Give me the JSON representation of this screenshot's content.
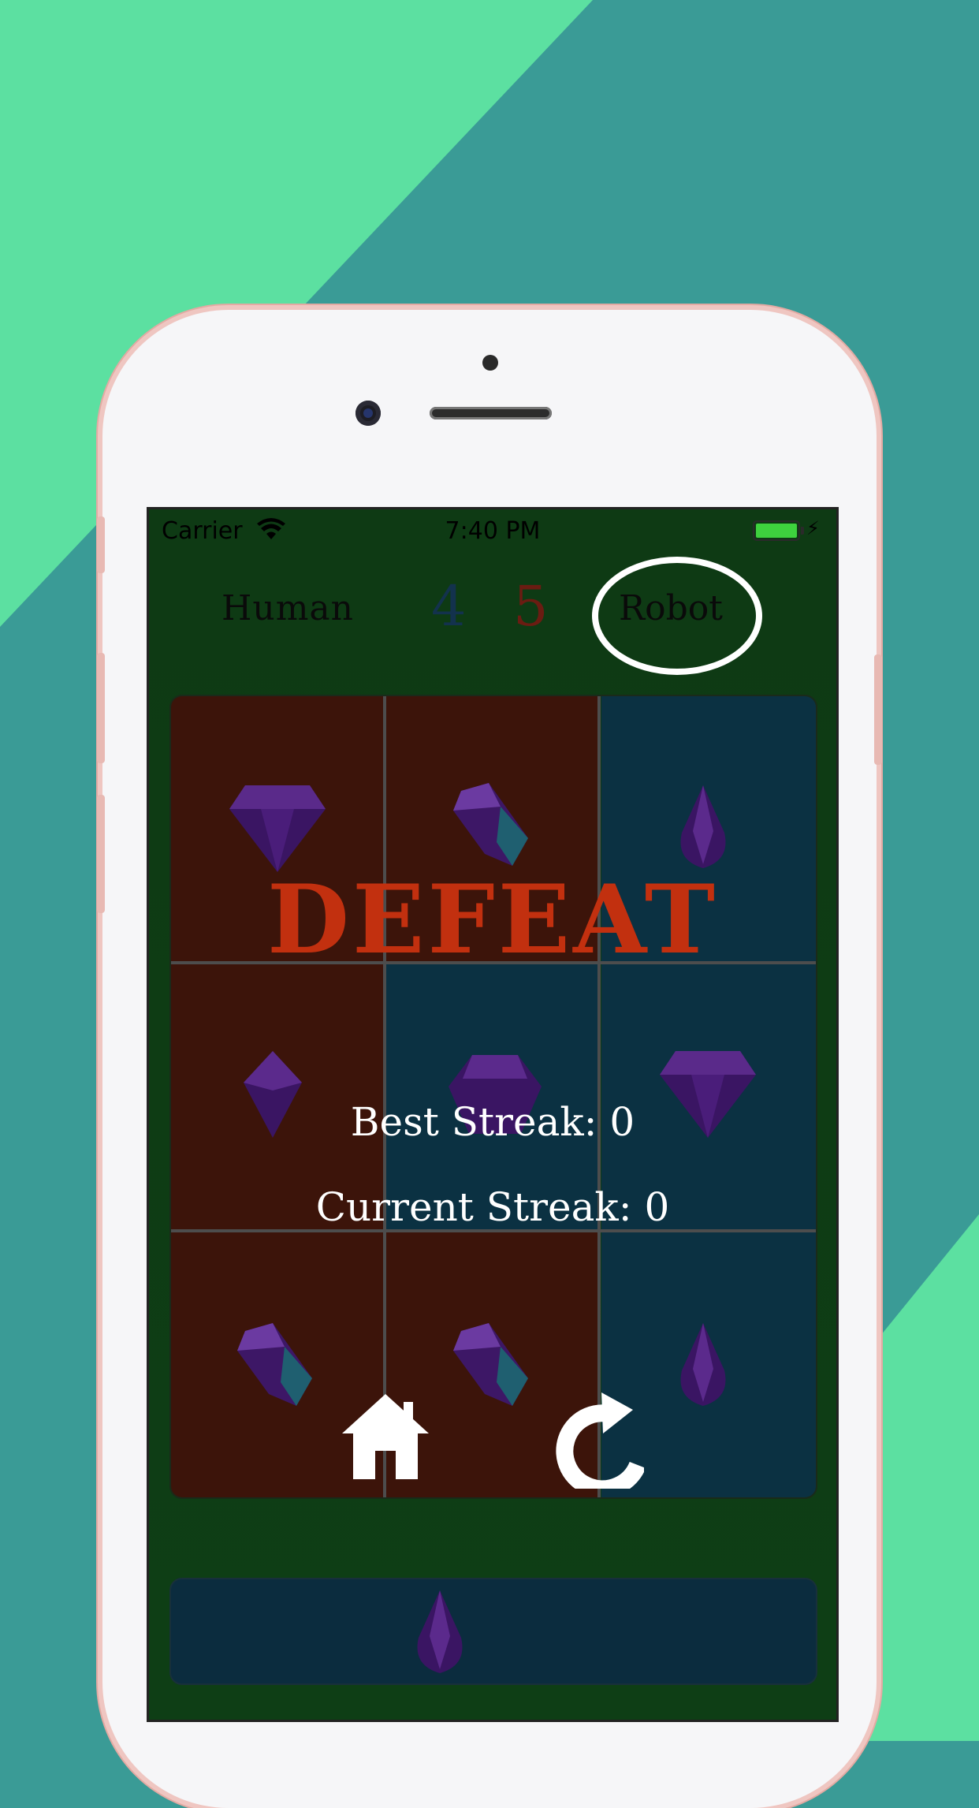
{
  "status_bar": {
    "carrier": "Carrier",
    "time": "7:40 PM",
    "icons": [
      "wifi-icon",
      "battery-icon",
      "charging-bolt-icon"
    ]
  },
  "score": {
    "player1_name": "Human",
    "player1_score": "4",
    "player2_score": "5",
    "player2_name": "Robot",
    "winner": "Robot"
  },
  "result": {
    "title": "DEFEAT",
    "best_streak": "Best Streak: 0",
    "current_streak": "Current Streak: 0"
  },
  "board": {
    "cells": [
      {
        "owner": "red",
        "gem": "purple-diamond-gem"
      },
      {
        "owner": "red",
        "gem": "purple-crystal-gem"
      },
      {
        "owner": "blue",
        "gem": "purple-teardrop-gem"
      },
      {
        "owner": "red",
        "gem": "purple-kite-gem"
      },
      {
        "owner": "blue",
        "gem": "purple-pentagon-gem"
      },
      {
        "owner": "blue",
        "gem": "purple-diamond-gem"
      },
      {
        "owner": "red",
        "gem": "purple-crystal-gem"
      },
      {
        "owner": "red",
        "gem": "purple-crystal-gem"
      },
      {
        "owner": "blue",
        "gem": "purple-teardrop-gem"
      }
    ]
  },
  "controls": {
    "home": "home-icon",
    "restart": "restart-icon"
  },
  "tray": {
    "gem": "purple-teardrop-gem"
  },
  "colors": {
    "defeat": "#c2300f",
    "red_cell": "#3c140a",
    "blue_cell": "#0b3142",
    "table_green": "#0e3a14"
  }
}
